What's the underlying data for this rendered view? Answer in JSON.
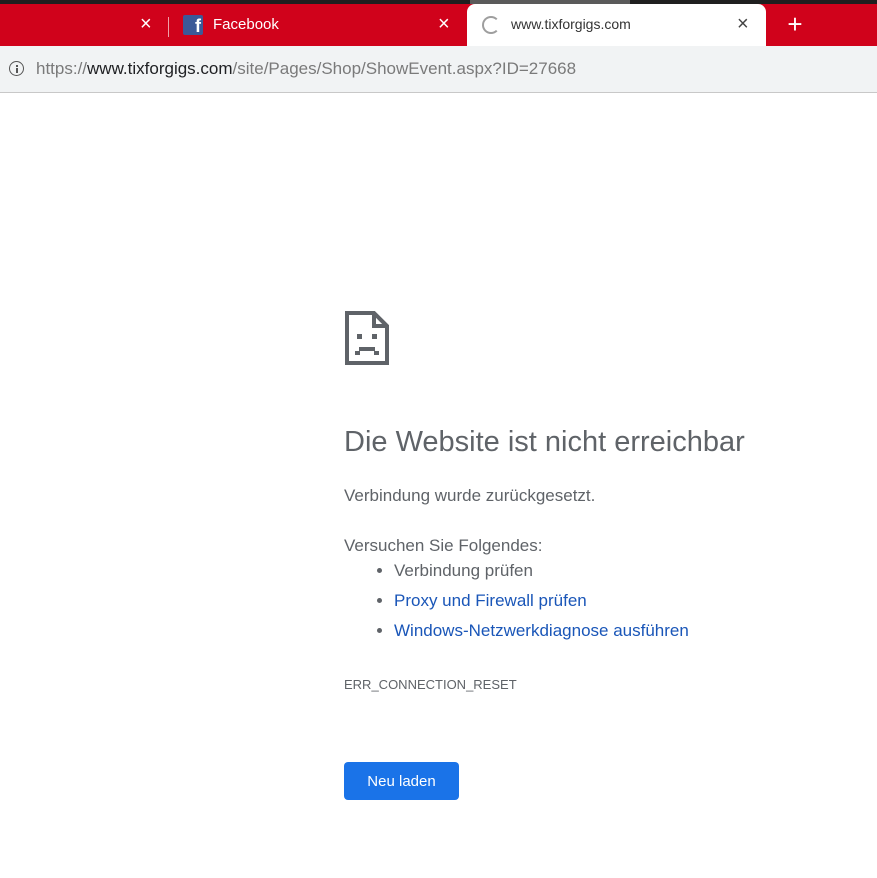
{
  "tabs": [
    {
      "title": "",
      "close": "×"
    },
    {
      "title": "Facebook",
      "favicon": "f",
      "close": "×"
    },
    {
      "title": "www.tixforgigs.com",
      "close": "×"
    }
  ],
  "newtab": "+",
  "address": {
    "scheme": "https://",
    "host": "www.tixforgigs.com",
    "path": "/site/Pages/Shop/ShowEvent.aspx?ID=27668"
  },
  "error": {
    "title": "Die Website ist nicht erreichbar",
    "message": "Verbindung wurde zurückgesetzt.",
    "try_label": "Versuchen Sie Folgendes:",
    "suggestions": [
      "Verbindung prüfen",
      "Proxy und Firewall prüfen",
      "Windows-Netzwerkdiagnose ausführen"
    ],
    "code": "ERR_CONNECTION_RESET",
    "reload_label": "Neu laden"
  },
  "colors": {
    "tabbar": "#d0021b",
    "link": "#1a56b8",
    "button": "#1a73e8"
  }
}
